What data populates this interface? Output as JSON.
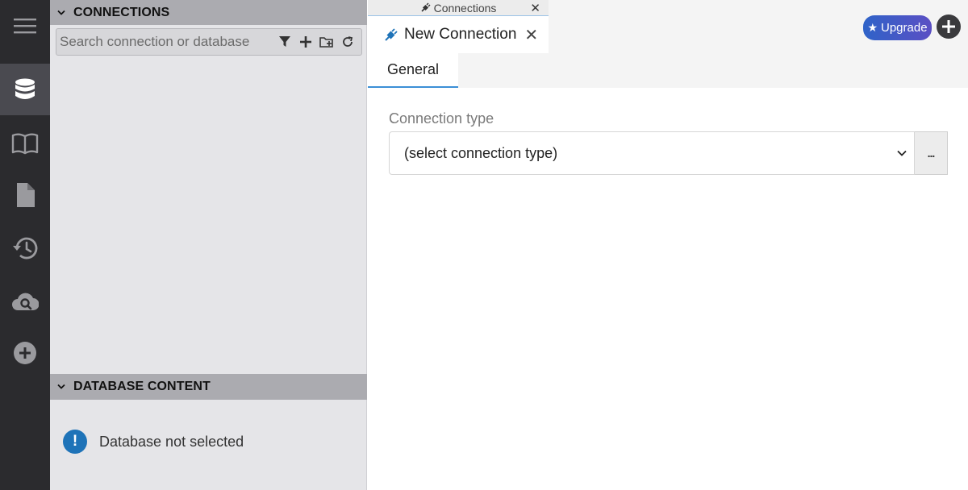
{
  "iconbar": {
    "items": [
      {
        "icon": "hamburger-menu-icon"
      },
      {
        "icon": "database-icon",
        "active": true
      },
      {
        "icon": "book-icon"
      },
      {
        "icon": "file-icon"
      },
      {
        "icon": "history-icon"
      },
      {
        "icon": "cloud-search-icon"
      },
      {
        "icon": "plus-circle-icon"
      }
    ]
  },
  "connections_panel": {
    "title": "CONNECTIONS",
    "search_placeholder": "Search connection or database",
    "actions": [
      "filter-icon",
      "add-icon",
      "add-folder-icon",
      "refresh-icon"
    ]
  },
  "database_panel": {
    "title": "DATABASE CONTENT",
    "message": "Database not selected"
  },
  "tabs": {
    "small_tab": {
      "label": "Connections",
      "close": "✕"
    },
    "main_tab": {
      "label": "New Connection",
      "close": "✕"
    }
  },
  "subtabs": [
    {
      "label": "General"
    }
  ],
  "toolbar": {
    "upgrade_label": "Upgrade"
  },
  "form": {
    "connection_type_label": "Connection type",
    "connection_type_value": "(select connection type)",
    "more_label": "..."
  },
  "colors": {
    "accent": "#3b8fd6",
    "upgrade_gradient_start": "#2f63c8",
    "upgrade_gradient_end": "#5b4fc4",
    "info": "#1e73b8"
  }
}
